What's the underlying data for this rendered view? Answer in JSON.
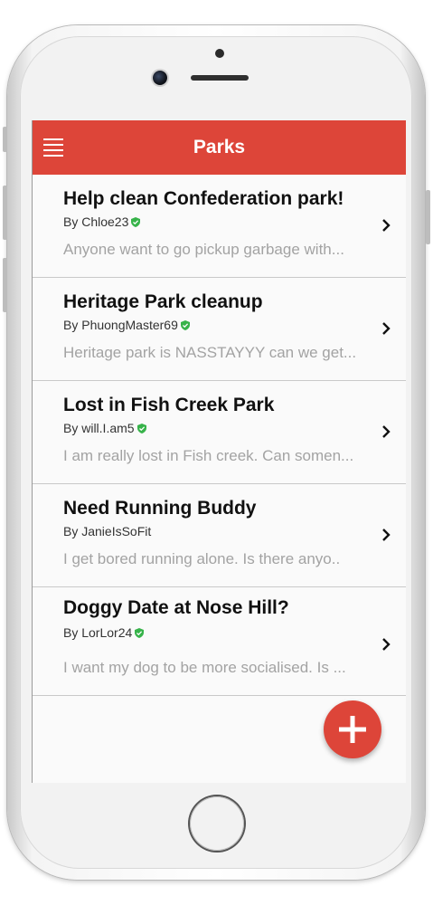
{
  "app_bar": {
    "title": "Parks",
    "color": "#dd4539"
  },
  "icons": {
    "menu": "hamburger-menu-icon",
    "verified": "shield-check-icon",
    "chevron": "chevron-right-icon",
    "add": "plus-icon"
  },
  "posts": [
    {
      "title": "Help clean Confederation park!",
      "author": "By Chloe23",
      "verified": true,
      "preview": "Anyone want to go pickup garbage with..."
    },
    {
      "title": "Heritage Park cleanup",
      "author": "By PhuongMaster69",
      "verified": true,
      "preview": "Heritage park is NASSTAYYY can we get..."
    },
    {
      "title": "Lost in Fish Creek Park",
      "author": "By will.I.am5",
      "verified": true,
      "preview": "I am really lost in Fish creek. Can somen..."
    },
    {
      "title": "Need Running Buddy",
      "author": "By JanieIsSoFit",
      "verified": false,
      "preview": "I get bored running alone. Is there anyo.."
    },
    {
      "title": "Doggy Date at Nose Hill?",
      "author": "By LorLor24",
      "verified": true,
      "preview": "I want my dog to be more socialised. Is ..."
    }
  ]
}
